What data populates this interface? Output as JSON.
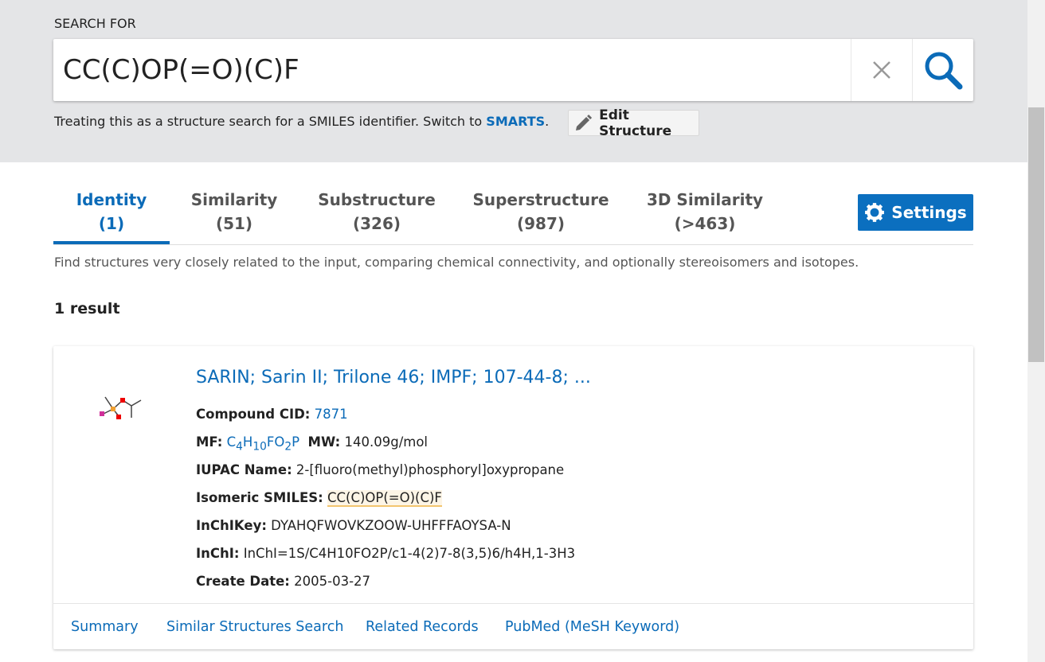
{
  "search": {
    "label": "SEARCH FOR",
    "value": "CC(C)OP(=O)(C)F",
    "note_prefix": "Treating this as a structure search for a SMILES identifier. Switch to ",
    "note_link": "SMARTS",
    "note_suffix": ".",
    "edit_label": "Edit Structure"
  },
  "tabs": [
    {
      "name": "Identity",
      "count": "(1)"
    },
    {
      "name": "Similarity",
      "count": "(51)"
    },
    {
      "name": "Substructure",
      "count": "(326)"
    },
    {
      "name": "Superstructure",
      "count": "(987)"
    },
    {
      "name": "3D Similarity",
      "count": "(>463)"
    }
  ],
  "settings_label": "Settings",
  "description": "Find structures very closely related to the input, comparing chemical connectivity, and optionally stereoisomers and isotopes.",
  "result_count": "1 result",
  "result": {
    "title": "SARIN; Sarin II; Trilone 46; IMPF; 107-44-8; ...",
    "cid_label": "Compound CID:",
    "cid": "7871",
    "mf_label": "MF:",
    "mf": {
      "c": "C",
      "c_n": "4",
      "h": "H",
      "h_n": "10",
      "f": "FO",
      "o_n": "2",
      "p": "P"
    },
    "mw_label": "MW:",
    "mw": "140.09g/mol",
    "iupac_label": "IUPAC Name:",
    "iupac": "2-[fluoro(methyl)phosphoryl]oxypropane",
    "smiles_label": "Isomeric SMILES:",
    "smiles": "CC(C)OP(=O)(C)F",
    "inchikey_label": "InChIKey:",
    "inchikey": "DYAHQFWOVKZOOW-UHFFFAOYSA-N",
    "inchi_label": "InChI:",
    "inchi": "InChI=1S/C4H10FO2P/c1-4(2)7-8(3,5)6/h4H,1-3H3",
    "date_label": "Create Date:",
    "date": "2005-03-27"
  },
  "footer_links": [
    "Summary",
    "Similar Structures Search",
    "Related Records",
    "PubMed (MeSH Keyword)"
  ],
  "colors": {
    "accent": "#0b6bb8",
    "header_bg": "#e4e5e7"
  }
}
